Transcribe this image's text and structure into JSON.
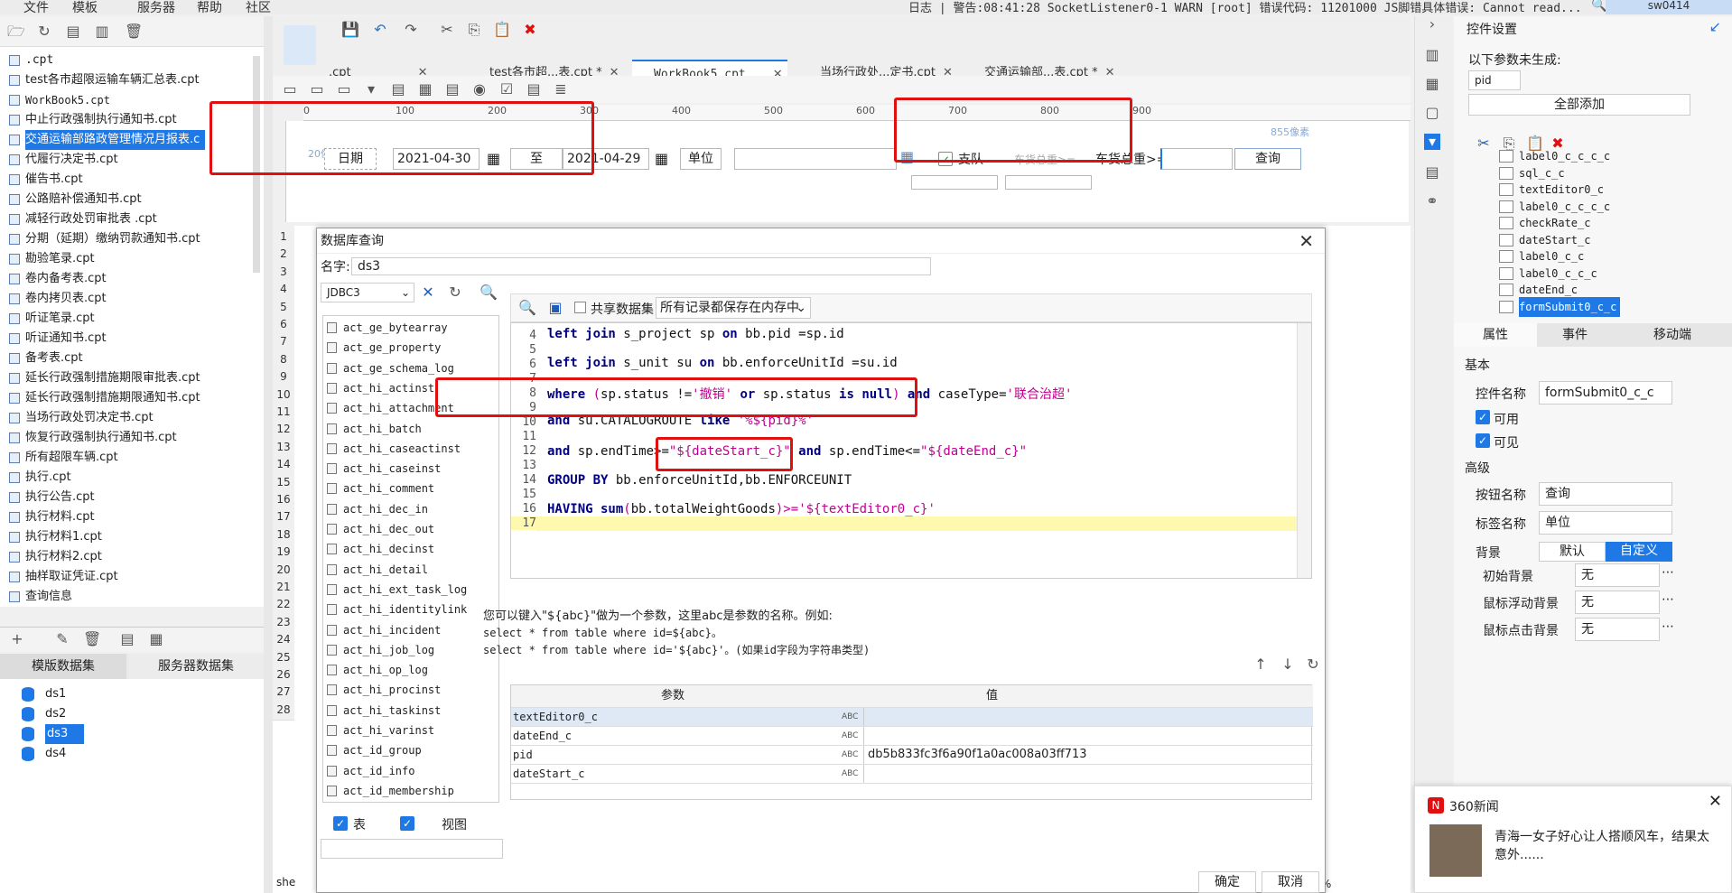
{
  "menubar": {
    "items": [
      "文件",
      "模板",
      "服务器",
      "帮助",
      "社区"
    ],
    "status": "日志 | 警告:08:41:28 SocketListener0-1 WARN [root] 错误代码: 11201000 JS脚错具体错误: Cannot read...",
    "user": "sw0414"
  },
  "files": [
    ".cpt",
    "test各市超限运输车辆汇总表.cpt",
    "WorkBook5.cpt",
    "中止行政强制执行通知书.cpt",
    "交通运输部路政管理情况月报表.c",
    "代履行决定书.cpt",
    "催告书.cpt",
    "公路赔补偿通知书.cpt",
    "减轻行政处罚审批表 .cpt",
    "分期（延期）缴纳罚款通知书.cpt",
    "勘验笔录.cpt",
    "卷内备考表.cpt",
    "卷内拷贝表.cpt",
    "听证笔录.cpt",
    "听证通知书.cpt",
    "备考表.cpt",
    "延长行政强制措施期限审批表.cpt",
    "延长行政强制措施期限通知书.cpt",
    "当场行政处罚决定书.cpt",
    "恢复行政强制执行通知书.cpt",
    "所有超限车辆.cpt",
    "执行.cpt",
    "执行公告.cpt",
    "执行材料.cpt",
    "执行材料1.cpt",
    "执行材料2.cpt",
    "抽样取证凭证.cpt",
    "查询信息"
  ],
  "dataset_tabs": {
    "template": "模版数据集",
    "server": "服务器数据集"
  },
  "datasets": [
    "ds1",
    "ds2",
    "ds3",
    "ds4"
  ],
  "tabs": [
    ".cpt",
    "test各市超...表.cpt *",
    "WorkBook5.cpt",
    "当场行政处...定书.cpt",
    "交通运输部...表.cpt *"
  ],
  "ruler": [
    "0",
    "100",
    "200",
    "300",
    "400",
    "500",
    "600",
    "700",
    "800",
    "900"
  ],
  "canvas": {
    "label_20px": "20像素",
    "label_855px": "855像素",
    "date_label": "日期",
    "date_start": "2021-04-30",
    "to": "至",
    "date_end": "2021-04-29",
    "unit": "单位",
    "detachment": "支队",
    "cargo_total_ghost": "车货总重>=",
    "cargo_total": "车货总重>=",
    "query": "查询"
  },
  "sheet_rows": [
    "1",
    "2",
    "3",
    "4",
    "5",
    "6",
    "7",
    "8",
    "9",
    "10",
    "11",
    "12",
    "13",
    "14",
    "15",
    "16",
    "17",
    "18",
    "19",
    "20",
    "21",
    "22",
    "23",
    "24",
    "25",
    "26",
    "27",
    "28"
  ],
  "dialog": {
    "title": "数据库查询",
    "name_label": "名字:",
    "name_value": "ds3",
    "connection": "JDBC3",
    "share_label": "共享数据集",
    "cache_option": "所有记录都保存在内存中",
    "tables": [
      "act_ge_bytearray",
      "act_ge_property",
      "act_ge_schema_log",
      "act_hi_actinst",
      "act_hi_attachment",
      "act_hi_batch",
      "act_hi_caseactinst",
      "act_hi_caseinst",
      "act_hi_comment",
      "act_hi_dec_in",
      "act_hi_dec_out",
      "act_hi_decinst",
      "act_hi_detail",
      "act_hi_ext_task_log",
      "act_hi_identitylink",
      "act_hi_incident",
      "act_hi_job_log",
      "act_hi_op_log",
      "act_hi_procinst",
      "act_hi_taskinst",
      "act_hi_varinst",
      "act_id_group",
      "act_id_info",
      "act_id_membership"
    ],
    "table_label": "表",
    "view_label": "视图",
    "hint_line1": "您可以键入\"${abc}\"做为一个参数，这里abc是参数的名称。例如:",
    "hint_line2": "select * from table where id=${abc}。",
    "hint_line3": "select * from table where id='${abc}'。(如果id字段为字符串类型)",
    "param_header": "参数",
    "value_header": "值",
    "params": [
      {
        "name": "textEditor0_c",
        "value": ""
      },
      {
        "name": "dateEnd_c",
        "value": ""
      },
      {
        "name": "pid",
        "value": "db5b833fc3f6a90f1a0ac008a03ff713"
      },
      {
        "name": "dateStart_c",
        "value": ""
      }
    ],
    "ok": "确定",
    "cancel": "取消"
  },
  "code": {
    "lines": [
      "4",
      "5",
      "6",
      "7",
      "8",
      "9",
      "10",
      "11",
      "12",
      "13",
      "14",
      "15",
      "16",
      "17"
    ],
    "l4a": "left join",
    "l4b": " s_project sp ",
    "l4c": "on",
    "l4d": " bb.pid =sp.id",
    "l6a": "left join",
    "l6b": " s_unit su ",
    "l6c": "on",
    "l6d": " bb.enforceUnitId =su.id",
    "l8a": "where",
    "l8b": " (",
    "l8c": "sp.status !=",
    "l8d": "'撤销'",
    "l8e": " or ",
    "l8f": "sp.status ",
    "l8g": "is null",
    "l8h": ") ",
    "l8i": "and",
    "l8j": " caseType=",
    "l8k": "'联合治超'",
    "l10a": "and",
    "l10b": "  su.CATALOGROUTE ",
    "l10c": "like",
    "l10d": " '%${pid}%'",
    "l12a": "and",
    "l12b": " sp.endTime>=",
    "l12c": "\"${dateStart_c}\"",
    "l12d": " and ",
    "l12e": "sp.endTime<=",
    "l12f": "\"${dateEnd_c}\"",
    "l14a": "GROUP BY",
    "l14b": " bb.enforceUnitId,bb.ENFORCEUNIT",
    "l16a": "HAVING",
    "l16b": " sum",
    "l16c": "(",
    "l16d": "bb.totalWeightGoods",
    "l16e": ")>=",
    "l16f": "'${textEditor0_c}'"
  },
  "right": {
    "title": "控件设置",
    "not_generated": "以下参数未生成:",
    "param_pid": "pid",
    "add_all": "全部添加",
    "tree": [
      "label0_c_c_c_c",
      "sql_c_c",
      "textEditor0_c",
      "label0_c_c_c_c",
      "checkRate_c",
      "dateStart_c",
      "label0_c_c",
      "label0_c_c_c",
      "dateEnd_c",
      "formSubmit0_c_c"
    ],
    "prop_tabs": [
      "属性",
      "事件",
      "移动端"
    ],
    "basic": "基本",
    "widget_name_label": "控件名称",
    "widget_name": "formSubmit0_c_c",
    "enabled": "可用",
    "visible": "可见",
    "advanced": "高级",
    "button_name_label": "按钮名称",
    "button_name": "查询",
    "tag_name_label": "标签名称",
    "tag_name": "单位",
    "bg_label": "背景",
    "bg_default": "默认",
    "bg_custom": "自定义",
    "init_bg": "初始背景",
    "init_bg_val": "无",
    "hover_bg": "鼠标浮动背景",
    "hover_bg_val": "无",
    "click_bg": "鼠标点击背景",
    "click_bg_val": "无"
  },
  "news": {
    "source": "360新闻",
    "headline": "青海一女子好心让人搭顺风车，结果太意外......"
  },
  "zoom": "100%",
  "sheet_tab": "she"
}
